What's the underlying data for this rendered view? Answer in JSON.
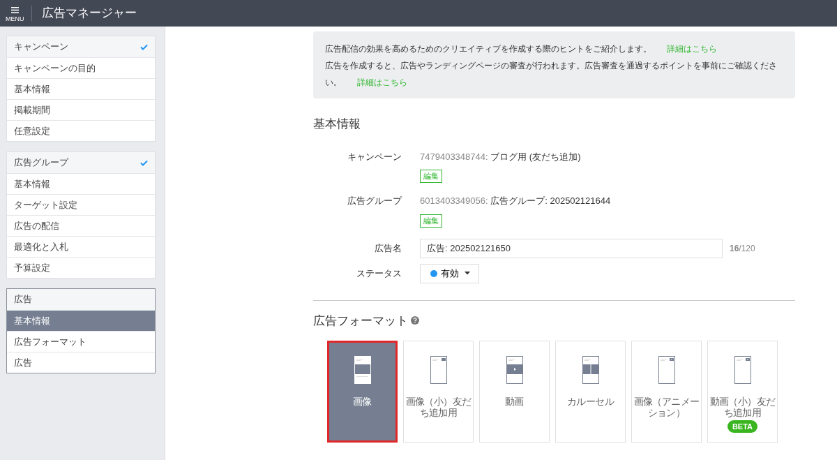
{
  "header": {
    "menu_label": "MENU",
    "title": "広告マネージャー"
  },
  "sidebar": {
    "groups": [
      {
        "active": false,
        "header": {
          "label": "キャンペーン",
          "checked": true
        },
        "items": [
          {
            "label": "キャンペーンの目的",
            "selected": false
          },
          {
            "label": "基本情報",
            "selected": false
          },
          {
            "label": "掲載期間",
            "selected": false
          },
          {
            "label": "任意設定",
            "selected": false
          }
        ]
      },
      {
        "active": false,
        "header": {
          "label": "広告グループ",
          "checked": true
        },
        "items": [
          {
            "label": "基本情報",
            "selected": false
          },
          {
            "label": "ターゲット設定",
            "selected": false
          },
          {
            "label": "広告の配信",
            "selected": false
          },
          {
            "label": "最適化と入札",
            "selected": false
          },
          {
            "label": "予算設定",
            "selected": false
          }
        ]
      },
      {
        "active": true,
        "header": {
          "label": "広告",
          "checked": false
        },
        "items": [
          {
            "label": "基本情報",
            "selected": true
          },
          {
            "label": "広告フォーマット",
            "selected": false
          },
          {
            "label": "広告",
            "selected": false
          }
        ]
      }
    ]
  },
  "notice": {
    "lines": [
      {
        "text": "広告配信の効果を高めるためのクリエイティブを作成する際のヒントをご紹介します。",
        "link": "詳細はこちら"
      },
      {
        "text": "広告を作成すると、広告やランディングページの審査が行われます。広告審査を通過するポイントを事前にご確認ください。",
        "link": "詳細はこちら"
      }
    ]
  },
  "basic_info": {
    "title": "基本情報",
    "rows": [
      {
        "kind": "info",
        "label": "キャンペーン",
        "id": "7479403348744:",
        "value": "ブログ用 (友だち追加)",
        "edit": "編集"
      },
      {
        "kind": "info",
        "label": "広告グループ",
        "id": "6013403349056:",
        "value": "広告グループ: 202502121644",
        "edit": "編集"
      },
      {
        "kind": "input",
        "label": "広告名",
        "value": "広告: 202502121650",
        "counter": "**16**/120"
      },
      {
        "kind": "status",
        "label": "ステータス",
        "value": "有効",
        "color": "#2196f3"
      }
    ]
  },
  "formats": {
    "title": "広告フォーマット",
    "items": [
      {
        "label": "画像",
        "kind": "image",
        "selected": true
      },
      {
        "label": "画像（小）友だち追加用",
        "kind": "small",
        "selected": false
      },
      {
        "label": "動画",
        "kind": "video",
        "selected": false
      },
      {
        "label": "カルーセル",
        "kind": "carousel",
        "selected": false
      },
      {
        "label": "画像（アニメーション）",
        "kind": "smallvideo",
        "selected": false
      },
      {
        "label": "動画（小）友だち追加用",
        "kind": "smallvideo",
        "selected": false,
        "badge": "BETA"
      }
    ]
  }
}
